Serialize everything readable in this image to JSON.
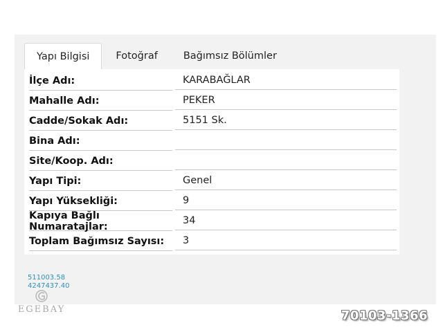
{
  "tabs": [
    "Yapı Bilgisi",
    "Fotoğraf",
    "Bağımsız Bölümler"
  ],
  "rows": [
    {
      "label": "İlçe Adı:",
      "value": "KARABAĞLAR"
    },
    {
      "label": "Mahalle Adı:",
      "value": "PEKER"
    },
    {
      "label": "Cadde/Sokak Adı:",
      "value": "5151 Sk."
    },
    {
      "label": "Bina Adı:",
      "value": ""
    },
    {
      "label": "Site/Koop. Adı:",
      "value": ""
    },
    {
      "label": "Yapı Tipi:",
      "value": "Genel"
    },
    {
      "label": "Yapı Yüksekliği:",
      "value": "9"
    },
    {
      "label": "Kapıya Bağlı Numaratajlar:",
      "value": "34"
    },
    {
      "label": "Toplam Bağımsız Sayısı:",
      "value": "3"
    }
  ],
  "coords": {
    "x": "511003.58",
    "y": "4247437.40"
  },
  "logo": {
    "name": "EGEBAY"
  },
  "listing_ref": "70103-1366"
}
